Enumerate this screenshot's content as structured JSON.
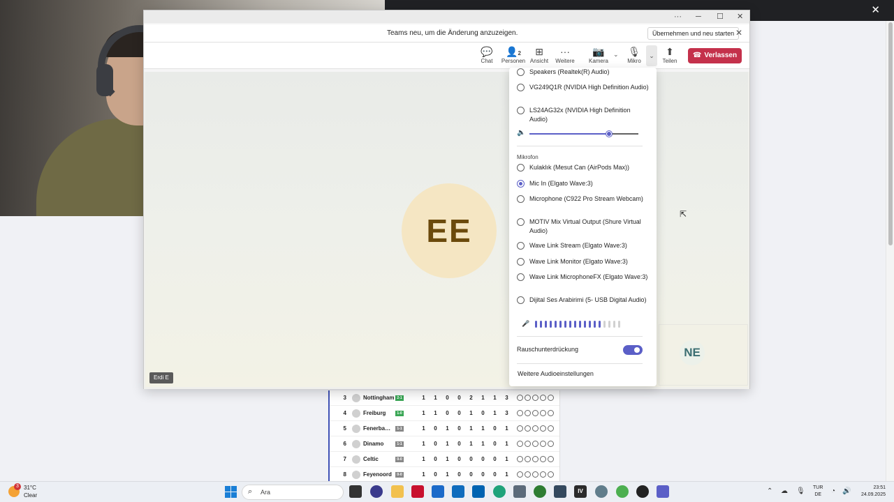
{
  "browser": {
    "close_glyph": "✕"
  },
  "league_table": {
    "rows": [
      {
        "rank": "3",
        "team": "Nottingham",
        "form": "2-1",
        "form_result": "win",
        "stats": [
          "1",
          "1",
          "0",
          "0",
          "2",
          "1",
          "1",
          "3"
        ]
      },
      {
        "rank": "4",
        "team": "Freiburg",
        "form": "1-0",
        "form_result": "win",
        "stats": [
          "1",
          "1",
          "0",
          "0",
          "1",
          "0",
          "1",
          "3"
        ]
      },
      {
        "rank": "5",
        "team": "Fenerba…",
        "form": "1-1",
        "form_result": "draw",
        "stats": [
          "1",
          "0",
          "1",
          "0",
          "1",
          "1",
          "0",
          "1"
        ]
      },
      {
        "rank": "6",
        "team": "Dinamo",
        "form": "1-1",
        "form_result": "draw",
        "stats": [
          "1",
          "0",
          "1",
          "0",
          "1",
          "1",
          "0",
          "1"
        ]
      },
      {
        "rank": "7",
        "team": "Celtic",
        "form": "0-0",
        "form_result": "draw",
        "stats": [
          "1",
          "0",
          "1",
          "0",
          "0",
          "0",
          "0",
          "1"
        ]
      },
      {
        "rank": "8",
        "team": "Feyenoord",
        "form": "0-0",
        "form_result": "draw",
        "stats": [
          "1",
          "0",
          "1",
          "0",
          "0",
          "0",
          "0",
          "1"
        ]
      }
    ]
  },
  "teams": {
    "window_controls": {
      "more": "···",
      "minimize": "─",
      "maximize": "☐",
      "close": "✕"
    },
    "banner": {
      "text": "Teams neu, um die Änderung anzuzeigen.",
      "button": "Übernehmen und neu starten",
      "close": "✕"
    },
    "toolbar": {
      "chat": "Chat",
      "people": "Personen",
      "people_count": "2",
      "view": "Ansicht",
      "more": "Weitere",
      "camera": "Kamera",
      "mic": "Mikro",
      "share": "Teilen",
      "leave": "Verlassen"
    },
    "stage": {
      "main_avatar_initials": "EE",
      "main_name_tag": "Erdi E",
      "side_avatar_initials": "NE"
    },
    "audio_flyout": {
      "speakers": [
        {
          "label": "Speakers (Realtek(R) Audio)",
          "selected": false
        },
        {
          "label": "VG249Q1R (NVIDIA High Definition Audio)",
          "selected": false
        },
        {
          "label": "LS24AG32x (NVIDIA High Definition Audio)",
          "selected": false
        }
      ],
      "speaker_volume": 0.73,
      "mic_section_label": "Mikrofon",
      "microphones": [
        {
          "label": "Kulaklık (Mesut Can (AirPods Max))",
          "selected": false
        },
        {
          "label": "Mic In (Elgato Wave:3)",
          "selected": true
        },
        {
          "label": "Microphone (C922 Pro Stream Webcam)",
          "selected": false
        },
        {
          "label": "MOTIV Mix Virtual Output (Shure Virtual Audio)",
          "selected": false
        },
        {
          "label": "Wave Link Stream (Elgato Wave:3)",
          "selected": false
        },
        {
          "label": "Wave Link Monitor (Elgato Wave:3)",
          "selected": false
        },
        {
          "label": "Wave Link MicrophoneFX (Elgato Wave:3)",
          "selected": false
        },
        {
          "label": "Dijital Ses Arabirimi (5- USB Digital Audio)",
          "selected": false
        }
      ],
      "mic_level_active": 14,
      "mic_level_total": 18,
      "noise_suppression_label": "Rauschunterdrückung",
      "noise_suppression_on": true,
      "more_settings_link": "Weitere Audioeinstellungen"
    }
  },
  "taskbar": {
    "weather_temp": "31°C",
    "weather_desc": "Clear",
    "weather_badge": "3",
    "search_placeholder": "Ara",
    "lang_top": "TUR",
    "lang_bottom": "DE",
    "time": "23:51",
    "date": "24.09.2025"
  },
  "colors": {
    "accent": "#5b5fc7",
    "leave_red": "#c4314b",
    "avatar_ee_bg": "#f5e6c3",
    "avatar_ee_fg": "#6b4a0c"
  }
}
